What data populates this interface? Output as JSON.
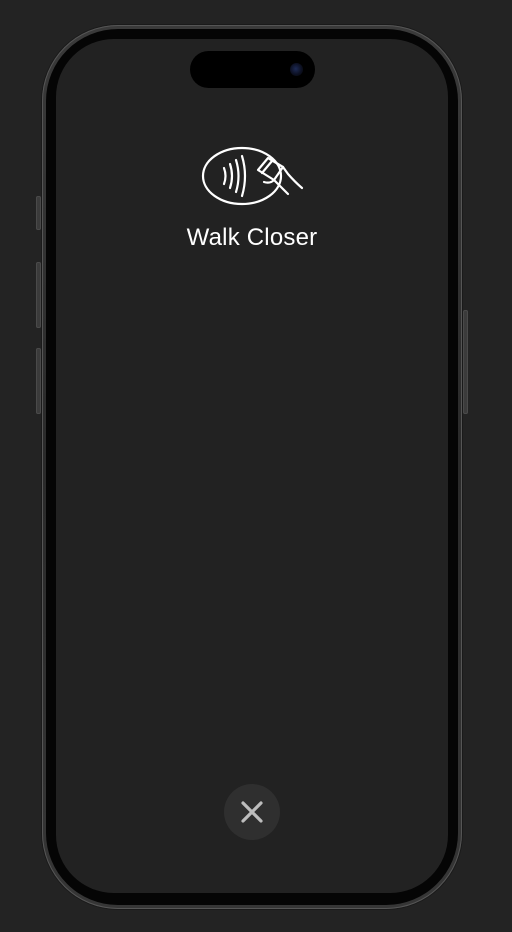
{
  "screen": {
    "status_text": "Walk Closer",
    "icon": "contactless-card-tap-icon"
  },
  "actions": {
    "cancel_icon": "close-icon"
  },
  "colors": {
    "background": "#232323",
    "screen": "#222222",
    "text": "#ffffff",
    "cancel_bg": "#2f2f2f",
    "cancel_glyph": "#bdbdbd"
  }
}
